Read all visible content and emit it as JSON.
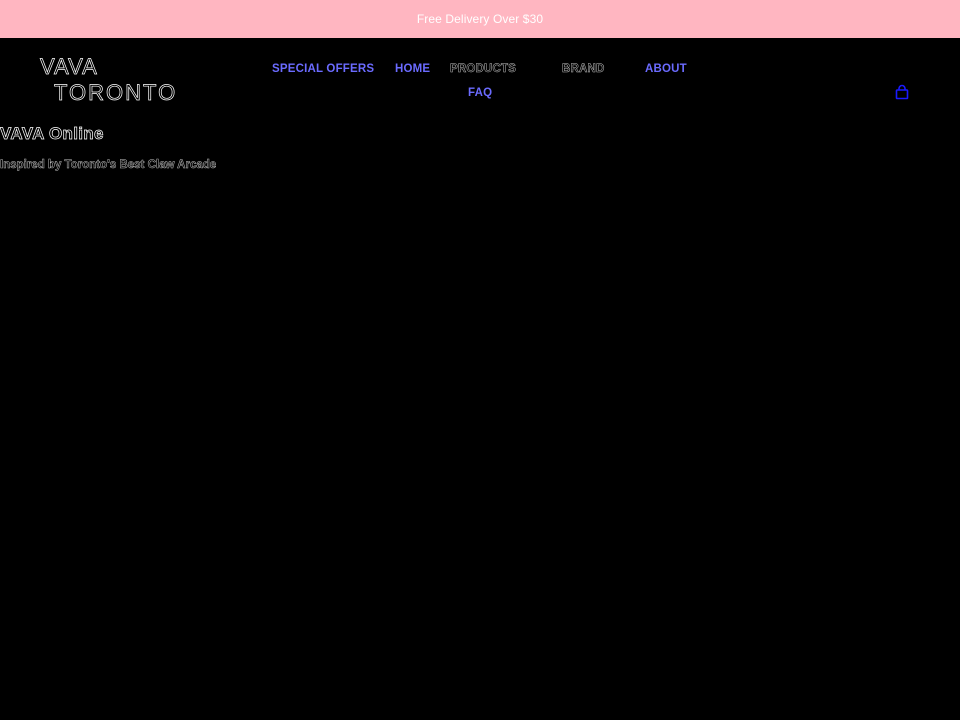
{
  "announcement": {
    "text": "Free Delivery Over $30"
  },
  "header": {
    "logo_line1": "VAVA",
    "logo_line2": "TORONTO",
    "nav": [
      {
        "label": "SPECIAL OFFERS"
      },
      {
        "label": "HOME"
      },
      {
        "label": "PRODUCTS"
      },
      {
        "label": "BRAND"
      },
      {
        "label": "ABOUT"
      },
      {
        "label": "FAQ"
      }
    ],
    "cart_icon": "cart-icon"
  },
  "hero": {
    "title": "VAVA Online",
    "subtitle": "Inspired by Toronto's Best Claw Arcade"
  },
  "colors": {
    "announcement_bg": "#ffb6c1",
    "page_bg": "#000000",
    "nav_accent": "#6b6bff",
    "cart_icon": "#1a1aff"
  }
}
